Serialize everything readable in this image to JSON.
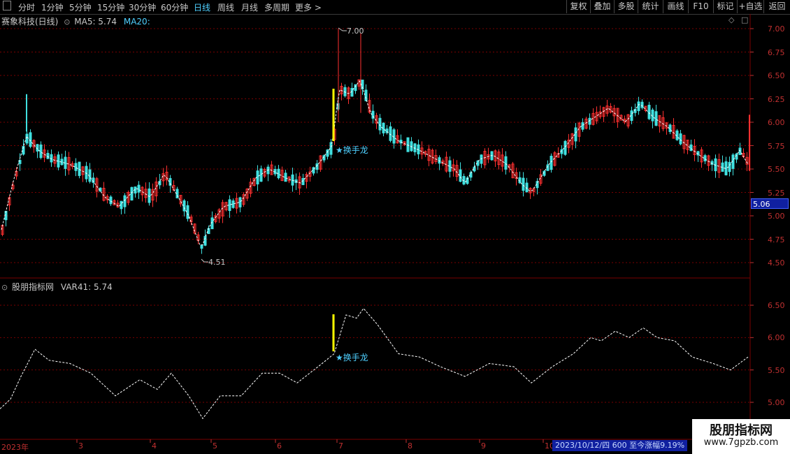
{
  "toolbar": {
    "periods": [
      "分时",
      "1分钟",
      "5分钟",
      "15分钟",
      "30分钟",
      "60分钟",
      "日线",
      "周线",
      "月线",
      "多周期",
      "更多"
    ],
    "active": "日线",
    "right_buttons": [
      "复权",
      "叠加",
      "多股",
      "统计",
      "画线",
      "F10",
      "标记",
      "+自选",
      "返回"
    ]
  },
  "main_title": {
    "name": "赛象科技(日线)",
    "ma5": "MA5: 5.74",
    "ma20": "MA20:"
  },
  "sub_title": {
    "name": "股朋指标网",
    "var": "VAR41: 5.74"
  },
  "price_axis": [
    "7.00",
    "6.75",
    "6.50",
    "6.25",
    "6.00",
    "5.75",
    "5.50",
    "5.25",
    "5.00",
    "4.75",
    "4.50"
  ],
  "sub_axis": [
    "6.50",
    "6.00",
    "5.50",
    "5.00"
  ],
  "current_price": "5.06",
  "high_label": "7.00",
  "low_label": "4.51",
  "annotation": "★换手龙",
  "dates": [
    "2023年",
    "3",
    "4",
    "5",
    "6",
    "7",
    "8",
    "9",
    "10"
  ],
  "status": "2023/10/12/四 600 至今涨幅9.19%",
  "watermark": {
    "title": "股朋指标网",
    "url": "www.7gpzb.com"
  },
  "colors": {
    "up": "#ff3030",
    "down": "#40e0e0",
    "ma": "#ffffff",
    "grid": "#7a0000",
    "accent": "#ffff00"
  }
}
